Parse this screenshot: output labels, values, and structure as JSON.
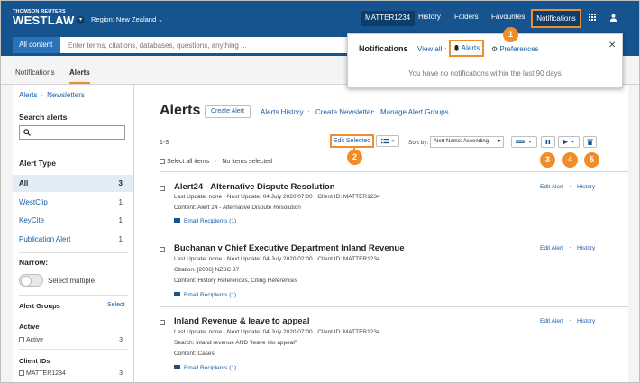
{
  "header": {
    "brand_small": "THOMSON REUTERS",
    "brand_big": "WESTLAW",
    "region": "Region: New Zealand",
    "matter": "MATTER1234",
    "nav": [
      "History",
      "Folders",
      "Favourites"
    ],
    "notifications": "Notifications"
  },
  "search": {
    "scope": "All content",
    "placeholder": "Enter terms, citations, databases, questions, anything ..."
  },
  "tabs": [
    "Notifications",
    "Alerts"
  ],
  "sidebar": {
    "crumbs": [
      "Alerts",
      "Newsletters"
    ],
    "search_title": "Search alerts",
    "alert_type_title": "Alert Type",
    "types": [
      {
        "label": "All",
        "count": "3"
      },
      {
        "label": "WestClip",
        "count": "1"
      },
      {
        "label": "KeyCite",
        "count": "1"
      },
      {
        "label": "Publication Alert",
        "count": "1"
      }
    ],
    "narrow": "Narrow:",
    "select_multiple": "Select multiple",
    "alert_groups": "Alert Groups",
    "select": "Select",
    "active_title": "Active",
    "active_item": "Active",
    "active_count": "3",
    "client_ids_title": "Client IDs",
    "client_item": "MATTER1234",
    "client_count": "3"
  },
  "main": {
    "title": "Alerts",
    "create_alert": "Create Alert",
    "links": [
      "Alerts History",
      "Create Newsletter",
      "Manage Alert Groups"
    ],
    "count": "1-3",
    "edit_selected": "Edit Selected",
    "sort_label": "Sort by:",
    "sort_value": "Alert Name: Ascending",
    "select_all": "Select all items",
    "no_items": "No items selected",
    "edit_alert": "Edit Alert",
    "history": "History",
    "alerts": [
      {
        "title": "Alert24 - Alternative Dispute Resolution",
        "line1": "Last Update: none  ·  Next Update: 04 July 2020 07:00  ·  Client ID: MATTER1234",
        "line2": "Content: Alert 24 - Alternative Dispute Resolution",
        "line3": "",
        "email": "Email Recipients (1)"
      },
      {
        "title": "Buchanan v Chief Executive Department Inland Revenue",
        "line1": "Last Update: none  ·  Next Update: 04 July 2020 02:00  ·  Client ID: MATTER1234",
        "line2": "Citation: [2006] NZSC 37",
        "line3": "Content: History References, Citing References",
        "email": "Email Recipients (1)"
      },
      {
        "title": "Inland Revenue & leave to appeal",
        "line1": "Last Update: none  ·  Next Update: 04 July 2020 07:00  ·  Client ID: MATTER1234",
        "line2": "Search: inland revenue AND \"leave #to appeal\"",
        "line3": "Content: Cases",
        "email": "Email Recipients (1)"
      }
    ]
  },
  "popup": {
    "title": "Notifications",
    "view_all": "View all",
    "alerts": "Alerts",
    "preferences": "Preferences",
    "empty": "You have no notifications within the last 90 days."
  },
  "badges": [
    "1",
    "2",
    "3",
    "4",
    "5"
  ],
  "colors": {
    "brand_blue": "#16548f",
    "accent_orange": "#f08c2a",
    "link_blue": "#1a5ea5"
  }
}
